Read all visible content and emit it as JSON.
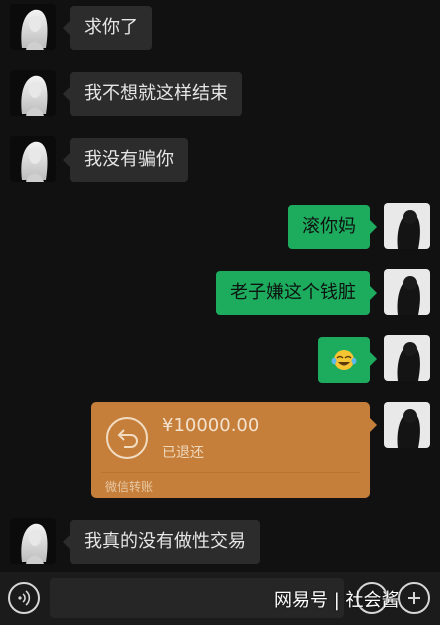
{
  "messages": {
    "m1": "求你了",
    "m2": "我不想就这样结束",
    "m3": "我没有骗你",
    "m4": "滚你妈",
    "m5": "老子嫌这个钱脏",
    "m6_emoji": "grinning-tears-emoji",
    "m8": "我真的没有做性交易"
  },
  "transfer": {
    "amount": "¥10000.00",
    "status": "已退还",
    "label": "微信转账",
    "color": "#c67f3a"
  },
  "bottom_bar": {
    "voice_icon": "voice-icon",
    "watermark": "网易号 | 社会酱"
  },
  "colors": {
    "incoming_bubble": "#2c2c2c",
    "outgoing_bubble": "#1dac5e",
    "background": "#111111"
  }
}
